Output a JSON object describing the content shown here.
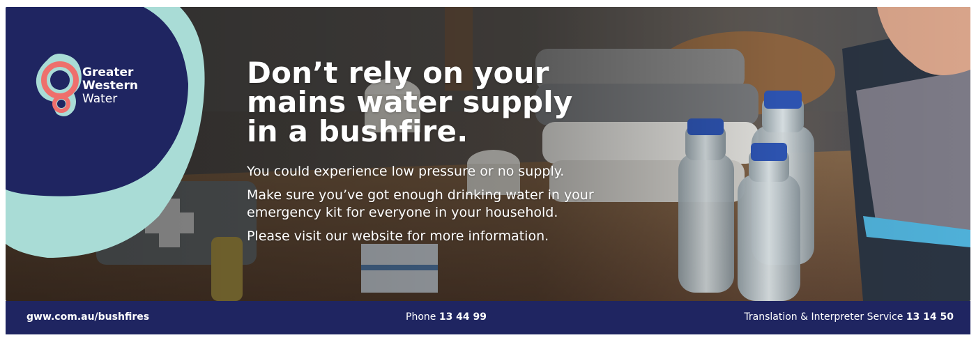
{
  "brand": {
    "name_line1": "Greater",
    "name_line2": "Western",
    "name_line3": "Water",
    "colors": {
      "navy": "#1f2561",
      "mint": "#a9dcd6",
      "coral": "#ef6f6c"
    },
    "logo_icon": "water-drop-ring-icon"
  },
  "headline": {
    "line1": "Don’t rely on your",
    "line2": "mains water supply",
    "line3": "in a bushfire."
  },
  "body": {
    "p1": "You could experience low pressure or no supply.",
    "p2_line1": "Make sure you’ve got enough drinking water in your",
    "p2_line2": "emergency kit for everyone in your household.",
    "p3": "Please visit our website for more information."
  },
  "footer": {
    "url": "gww.com.au/bushfires",
    "phone_label": "Phone",
    "phone_number": "13 44 99",
    "translation_label": "Translation & Interpreter Service",
    "translation_number": "13 14 50"
  }
}
